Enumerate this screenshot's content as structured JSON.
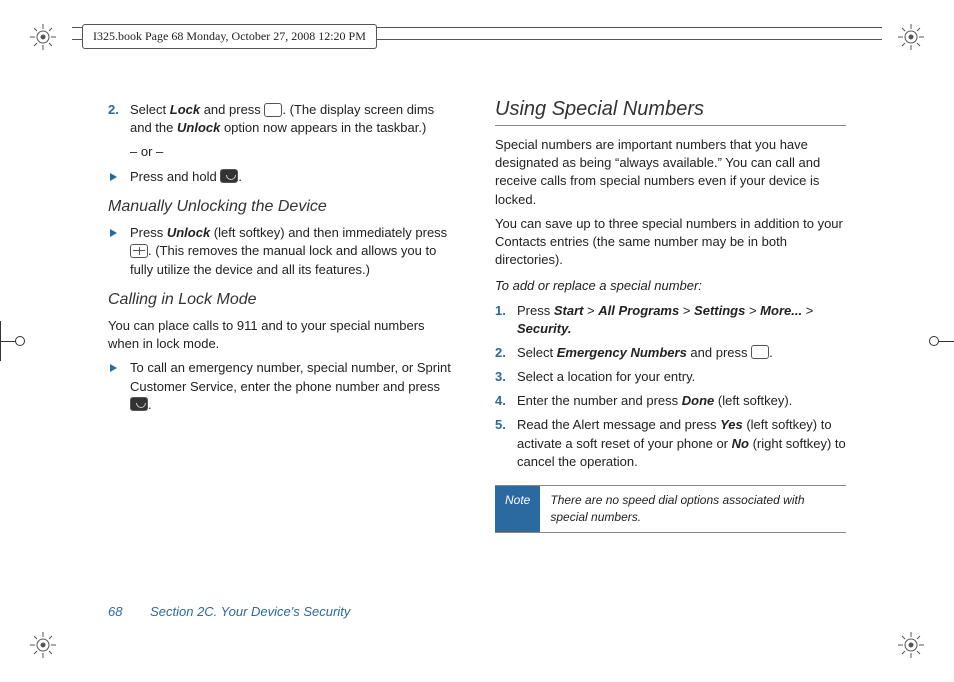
{
  "header": {
    "text": "I325.book  Page 68  Monday, October 27, 2008  12:20 PM"
  },
  "left": {
    "step2": {
      "num": "2.",
      "a": "Select ",
      "lock": "Lock",
      "b": " and press ",
      "c": ". (The display screen dims and the ",
      "unlock": "Unlock",
      "d": " option now appears in the taskbar.)",
      "or": "– or –",
      "pressHold": "Press and hold "
    },
    "h_unlock": "Manually Unlocking the Device",
    "unlock_bullet": {
      "a": "Press ",
      "unlock": "Unlock",
      "b": " (left softkey) and then immediately press  ",
      "c": ". (This removes the manual lock and allows you to fully utilize the device and all its features.)"
    },
    "h_lockmode": "Calling in Lock Mode",
    "lockmode_p": "You can place calls to 911 and to your special numbers when in lock mode.",
    "lockmode_bullet": {
      "a": "To call an emergency number, special number, or Sprint Customer Service, enter the phone number and press "
    }
  },
  "right": {
    "h1": "Using Special Numbers",
    "p1": "Special numbers are important numbers that you have designated as being “always available.” You can call and receive calls from special numbers even if your device is locked.",
    "p2": "You can save up to three special numbers in addition to your Contacts entries (the same number may be in both directories).",
    "instr": "To add or replace a special number:",
    "s1": {
      "num": "1.",
      "a": "Press ",
      "start": "Start",
      "gt1": " > ",
      "all": "All Programs",
      "gt2": " > ",
      "set": "Settings",
      "gt3": " > ",
      "more": "More...",
      "gt4": " > ",
      "sec": "Security."
    },
    "s2": {
      "num": "2.",
      "a": "Select ",
      "em": "Emergency Numbers",
      "b": " and press "
    },
    "s3": {
      "num": "3.",
      "a": "Select a location for your entry."
    },
    "s4": {
      "num": "4.",
      "a": "Enter the number and press ",
      "done": "Done",
      "b": " (left softkey)."
    },
    "s5": {
      "num": "5.",
      "a": "Read the Alert message and press ",
      "yes": "Yes",
      "b": " (left softkey) to activate a soft reset of your phone or ",
      "no": "No",
      "c": " (right softkey) to cancel the operation."
    },
    "note": {
      "label": "Note",
      "text": "There are no speed dial options associated with special numbers."
    }
  },
  "footer": {
    "page": "68",
    "section": "Section 2C. Your Device's Security"
  }
}
